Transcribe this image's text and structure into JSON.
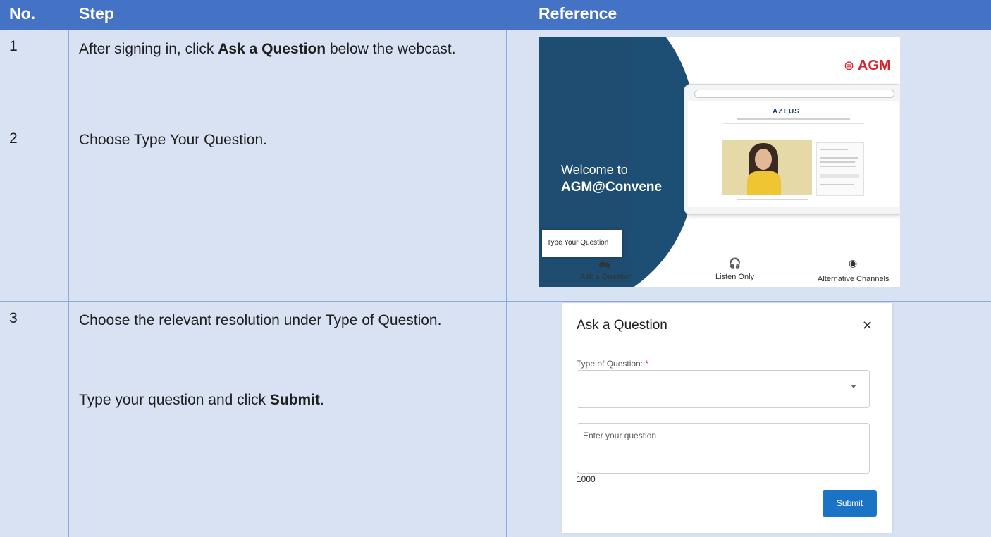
{
  "header": {
    "col_no": "No.",
    "col_step": "Step",
    "col_reference": "Reference"
  },
  "colors": {
    "header_bg": "#4472c4",
    "row_bg": "#d9e2f3",
    "border": "#8eaadb"
  },
  "rows": [
    {
      "no": "1",
      "text_before": "After signing in, click ",
      "bold": "Ask a Question",
      "text_after": " below the webcast."
    },
    {
      "no": "2",
      "text": "Choose Type Your Question."
    },
    {
      "no": "3",
      "line1": "Choose the relevant resolution under Type of Question.",
      "line2_before": "Type your question and click ",
      "line2_bold": "Submit",
      "line2_after": "."
    }
  ],
  "reference1": {
    "logo": "AGM",
    "welcome": "Welcome to",
    "brand": "AGM@Convene",
    "company": "AZEUS",
    "popup": "Type Your Question",
    "buttons": [
      {
        "label": "Ask a Question",
        "icon": "question-bubble-icon"
      },
      {
        "label": "Listen Only",
        "icon": "headphones-icon"
      },
      {
        "label": "Alternative Channels",
        "icon": "broadcast-icon"
      }
    ]
  },
  "reference2": {
    "title": "Ask a Question",
    "type_label": "Type of Question:",
    "required_mark": "*",
    "question_placeholder": "Enter your question",
    "char_count": "1000",
    "submit": "Submit"
  }
}
